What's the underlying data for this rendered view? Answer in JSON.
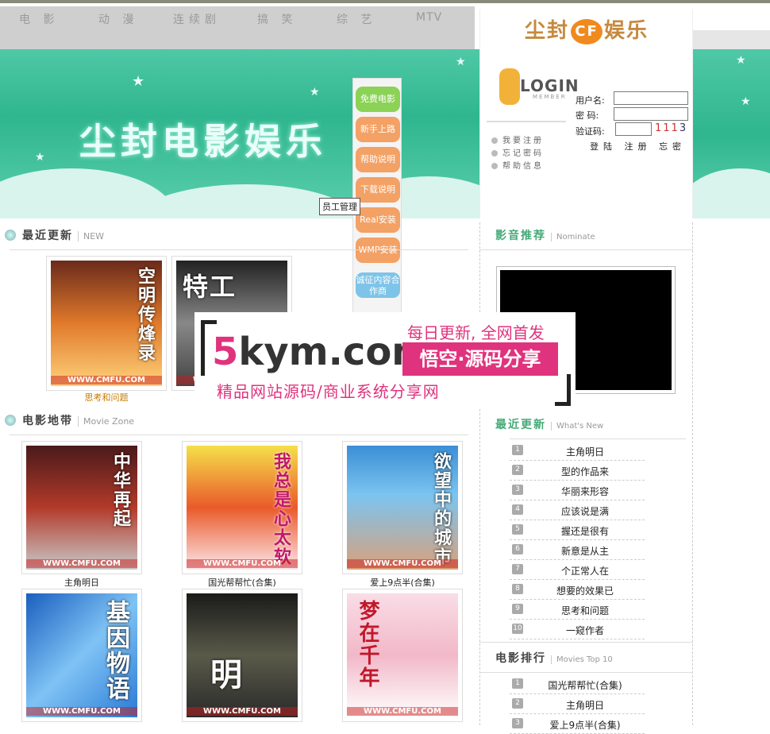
{
  "nav": {
    "items": [
      "电 影",
      "动 漫",
      "连续剧",
      "搞 笑",
      "综 艺",
      "MTV"
    ]
  },
  "banner": {
    "title": "尘封电影娱乐"
  },
  "side_buttons": [
    "免费电影",
    "新手上路",
    "帮助说明",
    "下载说明",
    "Real安装",
    "WMP安装",
    "诚征内容合作商"
  ],
  "tooltip": "员工管理",
  "login": {
    "logo_left": "尘封",
    "logo_mark": "CF",
    "logo_right": "娱乐",
    "login_word": "LOGIN",
    "login_sub": "MEMBER",
    "username_label": "用户名:",
    "password_label": "密  码:",
    "captcha_label": "验证码:",
    "captcha_a": "111",
    "captcha_b": "3",
    "links": "登陆 注册 忘密",
    "mini_links": [
      "我要注册",
      "忘记密码",
      "帮助信息"
    ]
  },
  "sections": {
    "recent": {
      "title": "最近更新",
      "en": "NEW"
    },
    "movie_zone": {
      "title": "电影地带",
      "en": "Movie Zone"
    }
  },
  "recent_posters": [
    {
      "text": "空明传烽录",
      "url": "WWW.CMFU.COM",
      "caption": "思考和问题"
    },
    {
      "text": "特工",
      "url": "WWW.CMFU.COM",
      "caption": ""
    }
  ],
  "zone_posters": [
    {
      "text": "中华再起",
      "url": "WWW.CMFU.COM",
      "caption": "主角明日"
    },
    {
      "text": "我总是心太软",
      "url": "WWW.CMFU.COM",
      "caption": "国光帮帮忙(合集)"
    },
    {
      "text": "欲望中的城市",
      "url": "WWW.CMFU.COM",
      "caption": "爱上9点半(合集)"
    },
    {
      "text": "基因物语",
      "url": "WWW.CMFU.COM",
      "caption": ""
    },
    {
      "text": "明",
      "url": "WWW.CMFU.COM",
      "caption": ""
    },
    {
      "text": "梦在千年",
      "url": "WWW.CMFU.COM",
      "caption": ""
    }
  ],
  "right": {
    "recommend": {
      "title": "影音推荐",
      "en": "Nominate"
    },
    "latest": {
      "title": "最近更新",
      "en": "What's New"
    },
    "latest_items": [
      "主角明日",
      "型的作品来",
      "华丽来形容",
      "应该说是满",
      "握还是很有",
      "新意是从主",
      "个正常人在",
      "想要的效果已",
      "思考和问题",
      "一窥作者"
    ],
    "top": {
      "title": "电影排行",
      "en": "Movies Top 10"
    },
    "top_items": [
      "国光帮帮忙(合集)",
      "主角明日",
      "爱上9点半(合集)"
    ]
  },
  "promo": {
    "five": "5",
    "domain": "kym.com",
    "top": "每日更新, 全网首发",
    "tag": "悟空·源码分享",
    "sub": "精品网站源码/商业系统分享网"
  }
}
